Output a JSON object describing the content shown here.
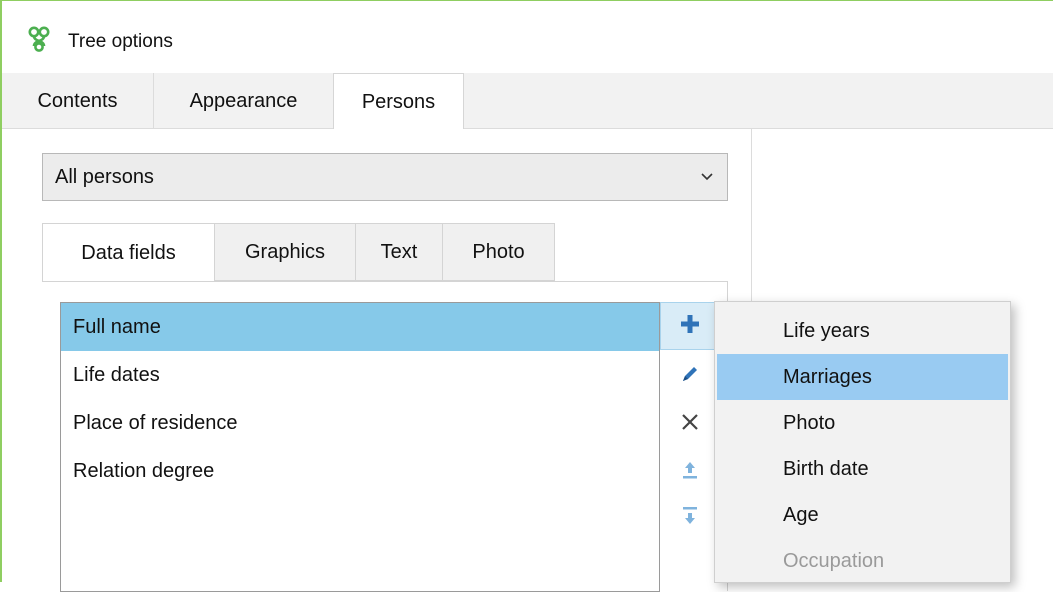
{
  "window": {
    "title": "Tree options",
    "accent_color": "#8fce61"
  },
  "main_tabs": [
    {
      "label": "Contents",
      "active": false
    },
    {
      "label": "Appearance",
      "active": false
    },
    {
      "label": "Persons",
      "active": true
    }
  ],
  "person_filter": {
    "selected": "All persons",
    "icon": "chevron-down-icon"
  },
  "sub_tabs": [
    {
      "label": "Data fields",
      "active": true
    },
    {
      "label": "Graphics",
      "active": false
    },
    {
      "label": "Text",
      "active": false
    },
    {
      "label": "Photo",
      "active": false
    }
  ],
  "data_fields": {
    "items": [
      "Full name",
      "Life dates",
      "Place of residence",
      "Relation degree"
    ],
    "selected_index": 0,
    "selection_color": "#86c9e9"
  },
  "toolbar": {
    "icons": [
      "add-icon",
      "edit-icon",
      "delete-icon",
      "move-up-icon",
      "move-down-icon"
    ]
  },
  "add_menu": {
    "items": [
      {
        "label": "Life years",
        "state": "normal"
      },
      {
        "label": "Marriages",
        "state": "hover"
      },
      {
        "label": "Photo",
        "state": "normal"
      },
      {
        "label": "Birth date",
        "state": "normal"
      },
      {
        "label": "Age",
        "state": "normal"
      },
      {
        "label": "Occupation",
        "state": "disabled"
      }
    ],
    "hover_color": "#99cbf2"
  }
}
